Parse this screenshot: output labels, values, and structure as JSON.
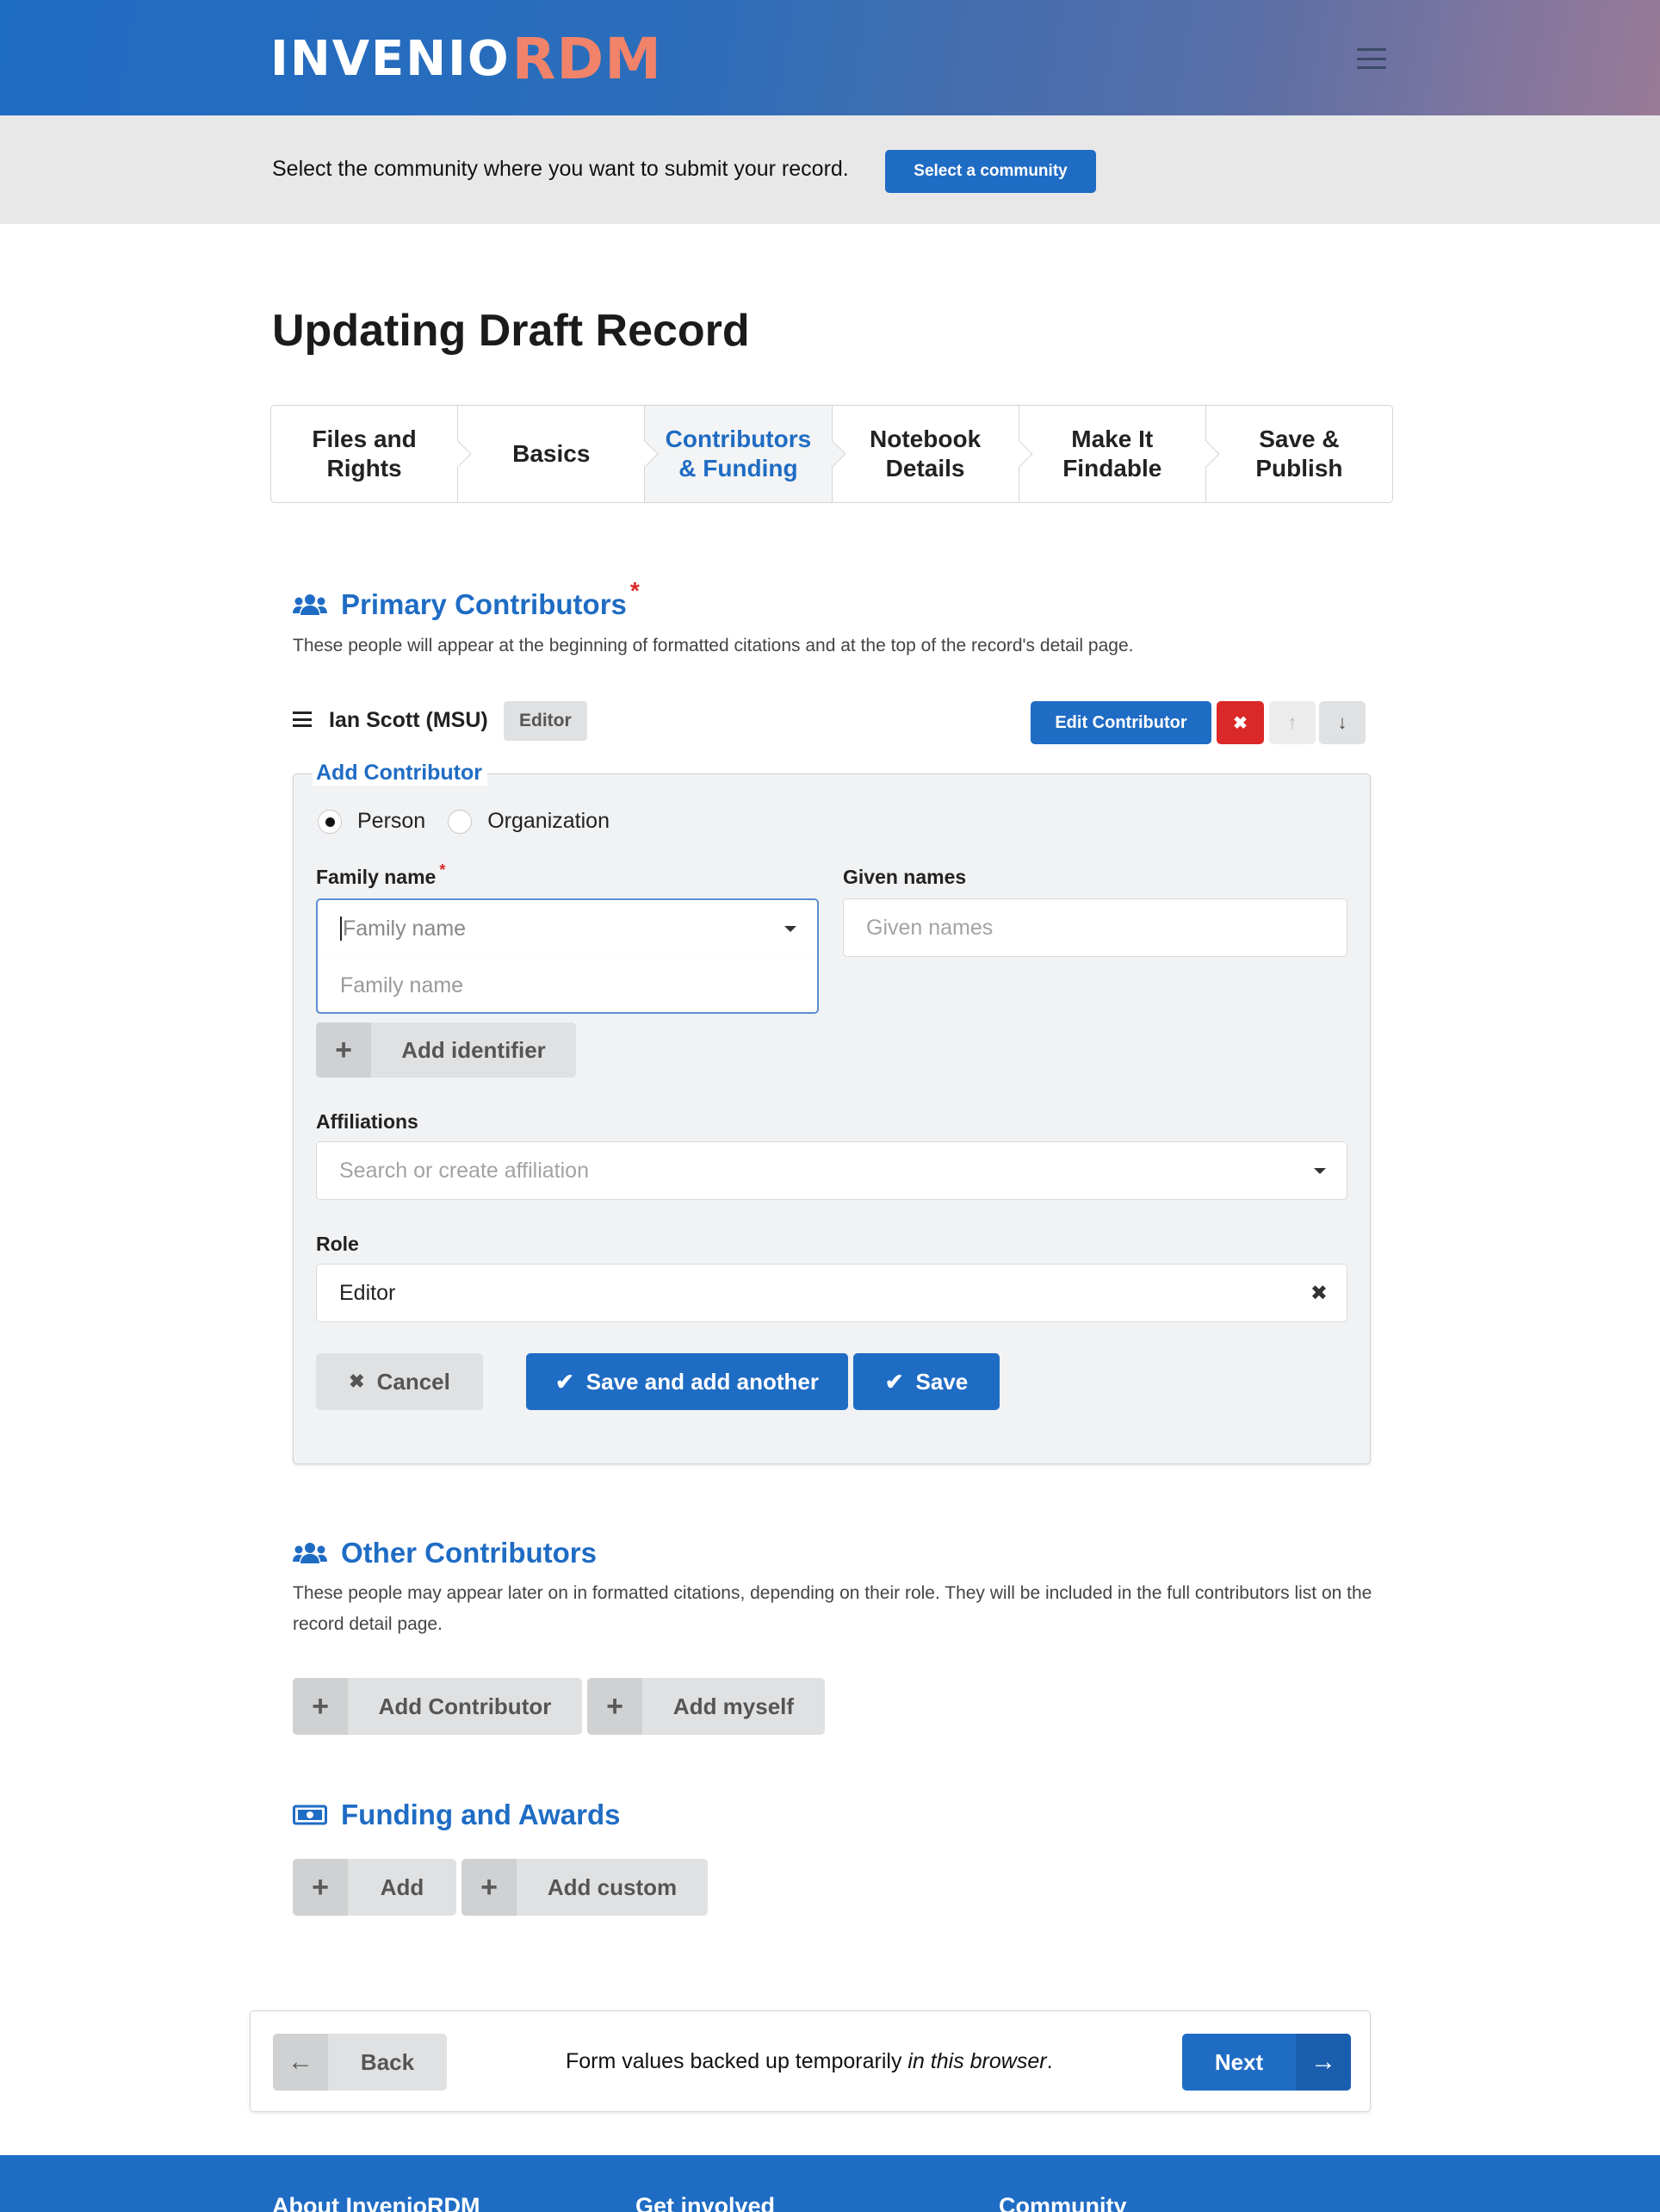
{
  "header": {
    "logo_part1": "INVENIO",
    "logo_part2": "RDM",
    "menu_icon": "hamburger-icon"
  },
  "community_banner": {
    "text": "Select the community where you want to submit your record.",
    "button_label": "Select a community"
  },
  "page_title": "Updating Draft Record",
  "steps": [
    {
      "label": "Files and Rights",
      "active": false
    },
    {
      "label": "Basics",
      "active": false
    },
    {
      "label": "Contributors & Funding",
      "active": true
    },
    {
      "label": "Notebook Details",
      "active": false
    },
    {
      "label": "Make It Findable",
      "active": false
    },
    {
      "label": "Save & Publish",
      "active": false
    }
  ],
  "primary_contributors": {
    "icon": "users-icon",
    "title": "Primary Contributors",
    "required_mark": "*",
    "description": "These people will appear at the beginning of formatted citations and at the top of the record's detail page.",
    "contributor": {
      "name": "Ian Scott (MSU)",
      "role": "Editor",
      "edit_label": "Edit Contributor",
      "delete_icon": "close-icon",
      "up_icon": "arrow-up-icon",
      "down_icon": "arrow-down-icon"
    }
  },
  "add_contributor_form": {
    "legend": "Add Contributor",
    "type_options": [
      {
        "label": "Person",
        "checked": true
      },
      {
        "label": "Organization",
        "checked": false
      }
    ],
    "family_name": {
      "label": "Family name",
      "required_mark": "*",
      "placeholder": "Family name",
      "dropdown_option": "Family name"
    },
    "given_names": {
      "label": "Given names",
      "placeholder": "Given names"
    },
    "add_identifier_label": "Add identifier",
    "affiliations": {
      "label": "Affiliations",
      "placeholder": "Search or create affiliation"
    },
    "role": {
      "label": "Role",
      "value": "Editor"
    },
    "cancel_label": "Cancel",
    "save_add_another_label": "Save and add another",
    "save_label": "Save"
  },
  "other_contributors": {
    "icon": "users-icon",
    "title": "Other Contributors",
    "description": "These people may appear later on in formatted citations, depending on their role. They will be included in the full contributors list on the record detail page.",
    "add_contributor_label": "Add Contributor",
    "add_myself_label": "Add myself"
  },
  "funding": {
    "icon": "money-bill-icon",
    "title": "Funding and Awards",
    "add_label": "Add",
    "add_custom_label": "Add custom"
  },
  "bottom_nav": {
    "back_label": "Back",
    "note_prefix": "Form values backed up temporarily ",
    "note_emphasis": "in this browser",
    "note_suffix": ".",
    "next_label": "Next"
  },
  "footer": {
    "columns": [
      "About InvenioRDM",
      "Get involved",
      "Community"
    ]
  },
  "colors": {
    "brand_blue": "#1f6cc4",
    "brand_orange": "#f2836b",
    "danger_red": "#db2828"
  }
}
